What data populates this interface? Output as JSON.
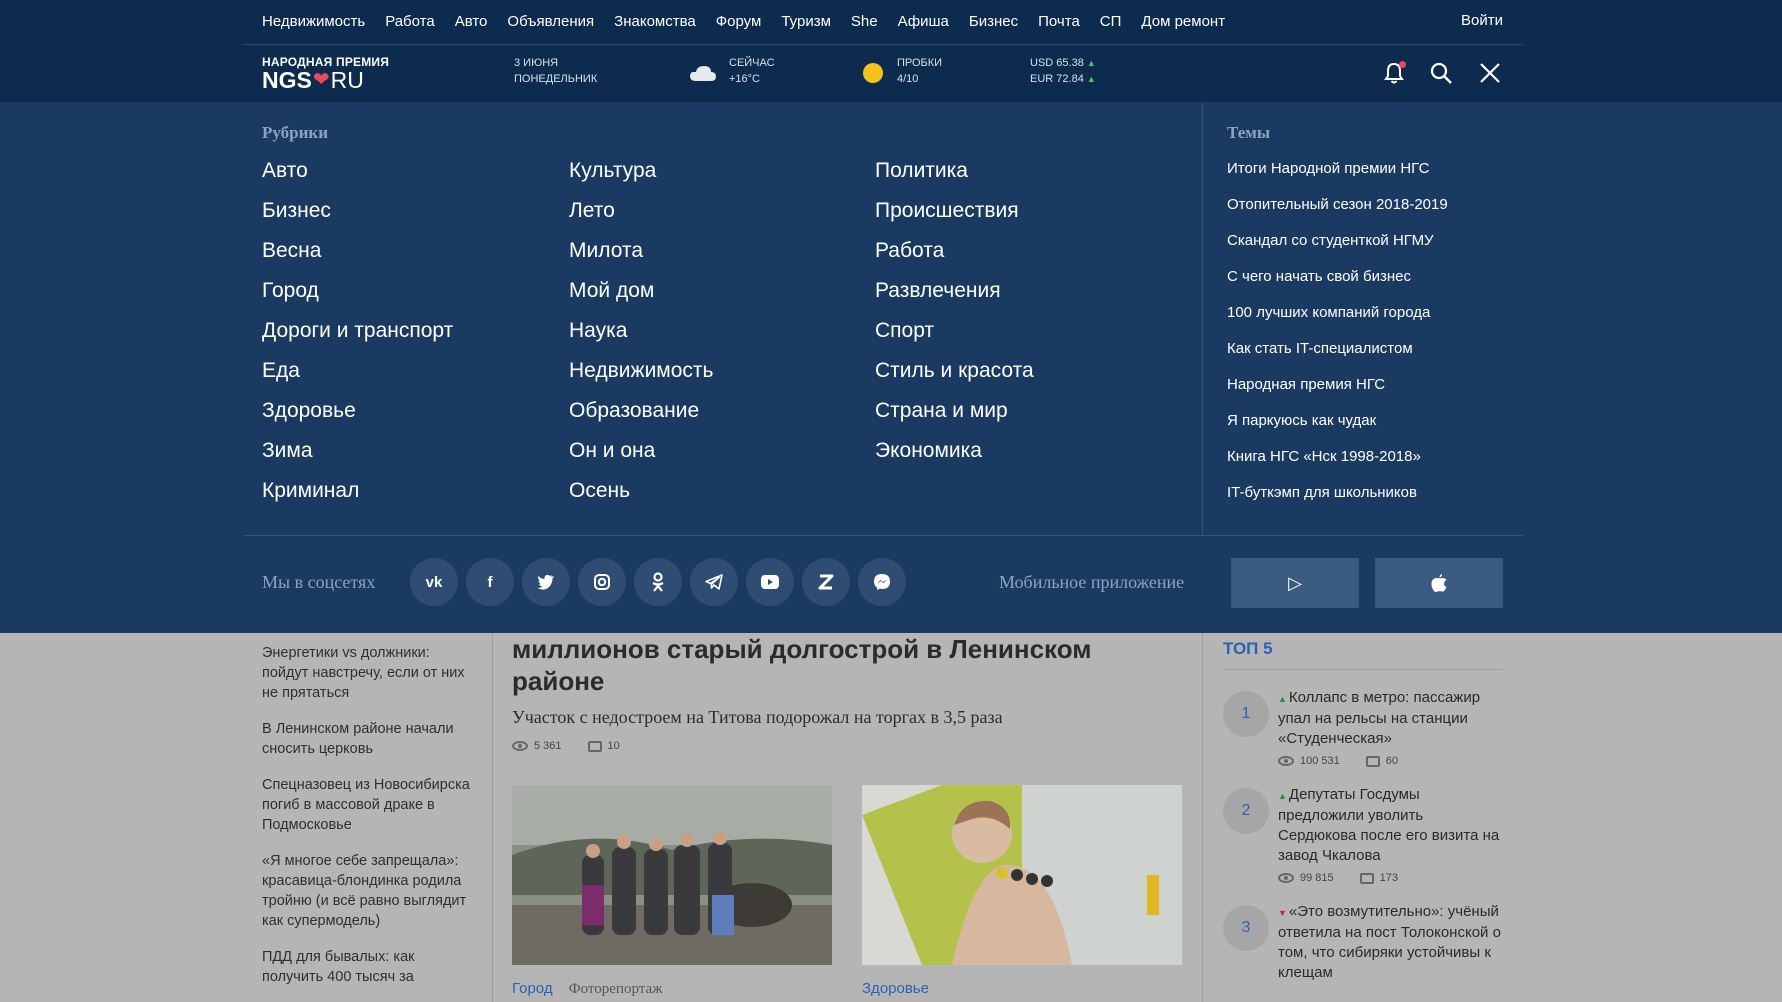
{
  "topnav": {
    "links": [
      "Недвижимость",
      "Работа",
      "Авто",
      "Объявления",
      "Знакомства",
      "Форум",
      "Туризм",
      "She",
      "Афиша",
      "Бизнес",
      "Почта",
      "СП",
      "Дом ремонт"
    ],
    "login": "Войти"
  },
  "logo": {
    "top": "НАРОДНАЯ ПРЕМИЯ",
    "brand_left": "NGS",
    "brand_right": "RU"
  },
  "info": {
    "date_line1": "3 ИЮНЯ",
    "date_line2": "ПОНЕДЕЛЬНИК",
    "weather_line1": "СЕЙЧАС",
    "weather_line2": "+16°C",
    "traffic_line1": "ПРОБКИ",
    "traffic_line2": "4/10",
    "usd": "USD 65.38",
    "eur": "EUR 72.84"
  },
  "menu": {
    "rubrics_title": "Рубрики",
    "col1": [
      "Авто",
      "Бизнес",
      "Весна",
      "Город",
      "Дороги и транспорт",
      "Еда",
      "Здоровье",
      "Зима",
      "Криминал"
    ],
    "col2": [
      "Культура",
      "Лето",
      "Милота",
      "Мой дом",
      "Наука",
      "Недвижимость",
      "Образование",
      "Он и она",
      "Осень"
    ],
    "col3": [
      "Политика",
      "Происшествия",
      "Работа",
      "Развлечения",
      "Спорт",
      "Стиль и красота",
      "Страна и мир",
      "Экономика"
    ],
    "themes_title": "Темы",
    "themes": [
      "Итоги Народной премии НГС",
      "Отопительный сезон 2018-2019",
      "Скандал со студенткой НГМУ",
      "С чего начать свой бизнес",
      "100 лучших компаний города",
      "Как стать IT-специалистом",
      "Народная премия НГС",
      "Я паркуюсь как чудак",
      "Книга НГС «Нск 1998-2018»",
      "IT-буткэмп для школьников"
    ],
    "social_label": "Мы в соцсетях",
    "socials": [
      "vk-icon",
      "facebook-icon",
      "twitter-icon",
      "instagram-icon",
      "odnoklassniki-icon",
      "telegram-icon",
      "youtube-icon",
      "zen-icon",
      "messenger-icon"
    ],
    "app_label": "Мобильное приложение"
  },
  "left_news": [
    "Энергетики vs должники: пойдут навстречу, если от них не прятаться",
    "В Ленинском районе начали сносить церковь",
    "Спецназовец из Новосибирска погиб в массовой драке в Подмосковье",
    "«Я многое себе запрещала»: красавица-блондинка родила тройню (и всё равно выглядит как супермодель)",
    "ПДД для бывалых: как получить 400 тысяч за"
  ],
  "article": {
    "title": "миллионов старый долгострой в Ленинском районе",
    "lead": "Участок с недостроем на Титова подорожал на торгах в 3,5 раза",
    "views": "5 361",
    "comments": "10",
    "card1_tag1": "Город",
    "card1_tag2": "Фоторепортаж",
    "card2_tag1": "Здоровье"
  },
  "top5": {
    "title": "ТОП 5",
    "items": [
      {
        "num": "1",
        "title": "Коллапс в метро: пассажир упал на рельсы на станции «Студенческая»",
        "views": "100 531",
        "comments": "60",
        "trend": "up"
      },
      {
        "num": "2",
        "title": "Депутаты Госдумы предложили уволить Сердюкова после его визита на завод Чкалова",
        "views": "99 815",
        "comments": "173",
        "trend": "up"
      },
      {
        "num": "3",
        "title": "«Это возмутительно»: учёный ответила на пост Толоконской о том, что сибиряки устойчивы к клещам",
        "views": "",
        "comments": "",
        "trend": "down"
      }
    ]
  }
}
